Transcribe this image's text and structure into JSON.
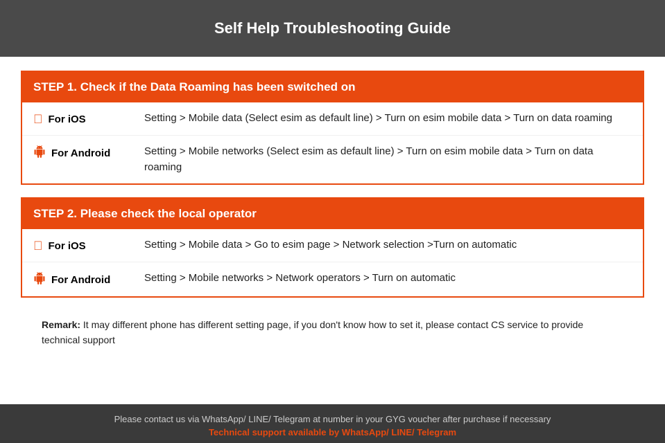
{
  "header": {
    "title": "Self Help Troubleshooting Guide"
  },
  "step1": {
    "header": "STEP 1.  Check if the Data Roaming has been switched on",
    "rows": [
      {
        "platform": "For iOS",
        "icon": "apple",
        "text": "Setting > Mobile data (Select esim as default line) > Turn on esim mobile data > Turn on data roaming"
      },
      {
        "platform": "For Android",
        "icon": "android",
        "text": "Setting > Mobile networks (Select esim as default line) > Turn on esim mobile data > Turn on data roaming"
      }
    ]
  },
  "step2": {
    "header": "STEP 2.  Please check the local operator",
    "rows": [
      {
        "platform": "For iOS",
        "icon": "apple",
        "text": "Setting > Mobile data > Go to esim page > Network selection >Turn on automatic"
      },
      {
        "platform": "For Android",
        "icon": "android",
        "text": "Setting > Mobile networks > Network operators > Turn on automatic"
      }
    ]
  },
  "remark": {
    "label": "Remark:",
    "text": " It may different phone has different setting page, if you don't know how to set it,  please contact CS service to provide technical support"
  },
  "footer": {
    "contact_text": "Please contact us via WhatsApp/ LINE/ Telegram at number in your GYG voucher after purchase if necessary",
    "support_text": "Technical support available by WhatsApp/ LINE/ Telegram"
  }
}
